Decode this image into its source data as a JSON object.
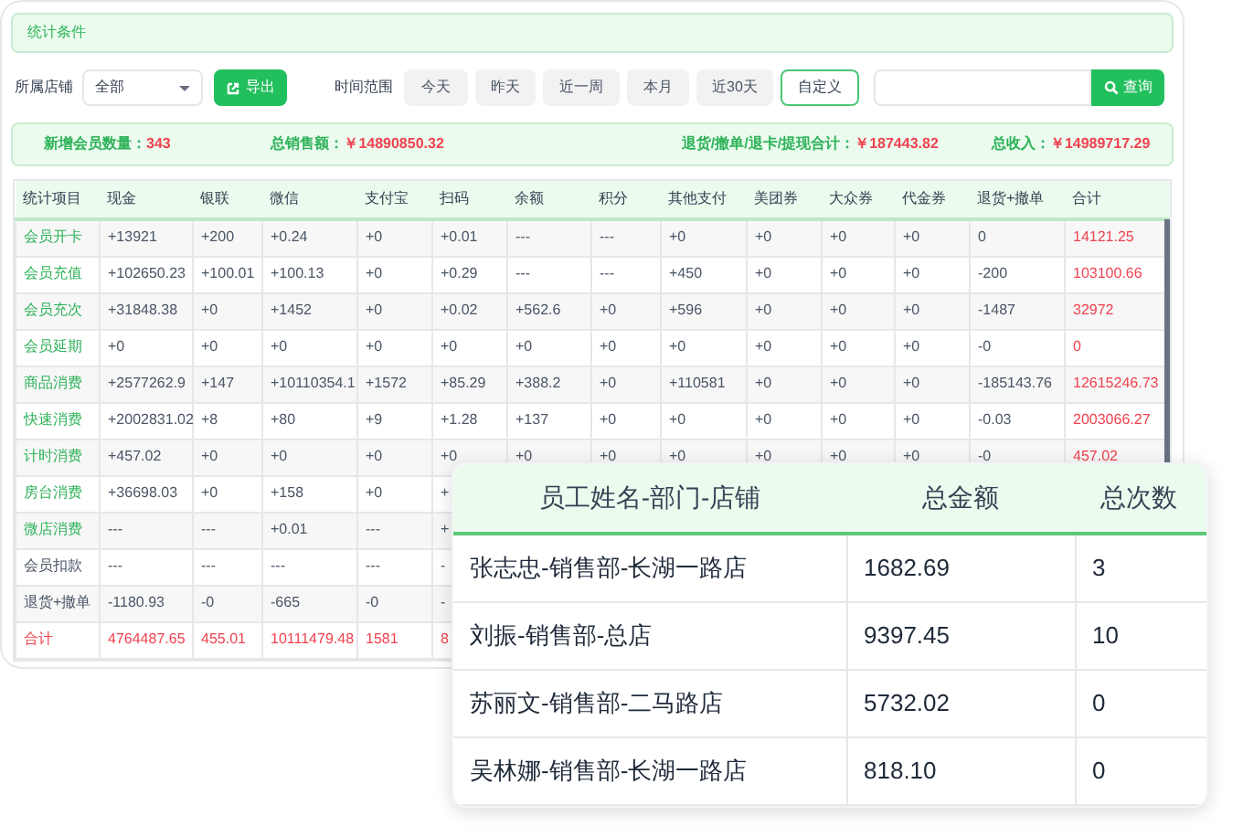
{
  "panel_title": "统计条件",
  "filters": {
    "store_label": "所属店铺",
    "store_value": "全部",
    "export_label": "导出",
    "time_label": "时间范围",
    "time_ranges": [
      {
        "label": "今天",
        "selected": false
      },
      {
        "label": "昨天",
        "selected": false
      },
      {
        "label": "近一周",
        "selected": false
      },
      {
        "label": "本月",
        "selected": false
      },
      {
        "label": "近30天",
        "selected": false
      },
      {
        "label": "自定义",
        "selected": true
      }
    ],
    "query_label": "查询"
  },
  "summary": [
    {
      "label": "新增会员数量：",
      "value": "343"
    },
    {
      "label": "总销售额：",
      "value": "￥14890850.32"
    },
    {
      "label": "退货/撤单/退卡/提现合计：",
      "value": "￥187443.82"
    },
    {
      "label": "总收入：",
      "value": "￥14989717.29"
    }
  ],
  "table": {
    "columns": [
      "统计项目",
      "现金",
      "银联",
      "微信",
      "支付宝",
      "扫码",
      "余额",
      "积分",
      "其他支付",
      "美团券",
      "大众券",
      "代金券",
      "退货+撤单",
      "合计"
    ],
    "rows": [
      {
        "kind": "link",
        "cells": [
          "会员开卡",
          "+13921",
          "+200",
          "+0.24",
          "+0",
          "+0.01",
          "---",
          "---",
          "+0",
          "+0",
          "+0",
          "+0",
          "0",
          "14121.25"
        ]
      },
      {
        "kind": "link",
        "cells": [
          "会员充值",
          "+102650.23",
          "+100.01",
          "+100.13",
          "+0",
          "+0.29",
          "---",
          "---",
          "+450",
          "+0",
          "+0",
          "+0",
          "-200",
          "103100.66"
        ]
      },
      {
        "kind": "link",
        "cells": [
          "会员充次",
          "+31848.38",
          "+0",
          "+1452",
          "+0",
          "+0.02",
          "+562.6",
          "+0",
          "+596",
          "+0",
          "+0",
          "+0",
          "-1487",
          "32972"
        ]
      },
      {
        "kind": "link",
        "cells": [
          "会员延期",
          "+0",
          "+0",
          "+0",
          "+0",
          "+0",
          "+0",
          "+0",
          "+0",
          "+0",
          "+0",
          "+0",
          "-0",
          "0"
        ]
      },
      {
        "kind": "link",
        "cells": [
          "商品消费",
          "+2577262.9",
          "+147",
          "+10110354.1",
          "+1572",
          "+85.29",
          "+388.2",
          "+0",
          "+110581",
          "+0",
          "+0",
          "+0",
          "-185143.76",
          "12615246.73"
        ]
      },
      {
        "kind": "link",
        "cells": [
          "快速消费",
          "+2002831.02",
          "+8",
          "+80",
          "+9",
          "+1.28",
          "+137",
          "+0",
          "+0",
          "+0",
          "+0",
          "+0",
          "-0.03",
          "2003066.27"
        ]
      },
      {
        "kind": "link",
        "cells": [
          "计时消费",
          "+457.02",
          "+0",
          "+0",
          "+0",
          "+0",
          "+0",
          "+0",
          "+0",
          "+0",
          "+0",
          "+0",
          "-0",
          "457.02"
        ]
      },
      {
        "kind": "link",
        "cells": [
          "房台消费",
          "+36698.03",
          "+0",
          "+158",
          "+0",
          "+"
        ]
      },
      {
        "kind": "link",
        "cells": [
          "微店消费",
          "---",
          "---",
          "+0.01",
          "---",
          "+"
        ]
      },
      {
        "kind": "plain",
        "cells": [
          "会员扣款",
          "---",
          "---",
          "---",
          "---",
          "-"
        ]
      },
      {
        "kind": "plain",
        "cells": [
          "退货+撤单",
          "-1180.93",
          "-0",
          "-665",
          "-0",
          "-"
        ]
      },
      {
        "kind": "total",
        "cells": [
          "合计",
          "4764487.65",
          "455.01",
          "10111479.48",
          "1581",
          "8"
        ]
      }
    ]
  },
  "staff_table": {
    "columns": [
      "员工姓名-部门-店铺",
      "总金额",
      "总次数"
    ],
    "rows": [
      [
        "张志忠-销售部-长湖一路店",
        "1682.69",
        "3"
      ],
      [
        "刘振-销售部-总店",
        "9397.45",
        "10"
      ],
      [
        "苏丽文-销售部-二马路店",
        "5732.02",
        "0"
      ],
      [
        "吴林娜-销售部-长湖一路店",
        "818.10",
        "0"
      ]
    ]
  }
}
